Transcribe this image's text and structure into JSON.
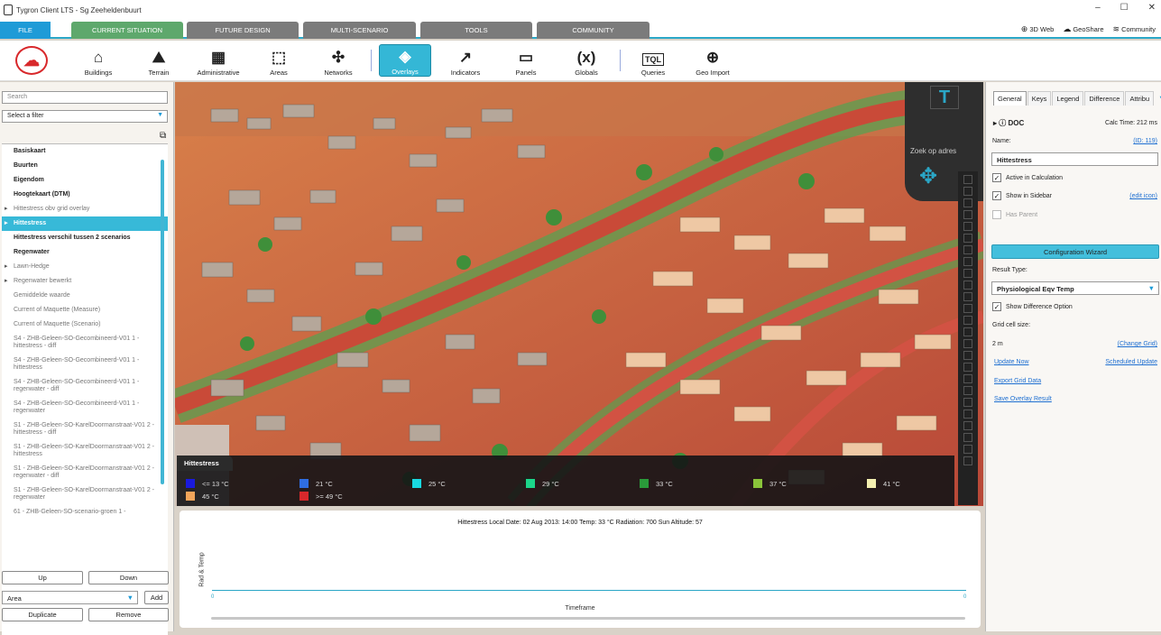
{
  "window": {
    "title": "Tygron Client LTS - Sg Zeeheldenbuurt",
    "minimize": "–",
    "maximize": "☐",
    "close": "✕"
  },
  "tabs": {
    "file": "FILE",
    "current": "CURRENT SITUATION",
    "future": "FUTURE DESIGN",
    "multi": "MULTI-SCENARIO",
    "tools": "TOOLS",
    "community": "COMMUNITY"
  },
  "top_links": {
    "web": "3D Web",
    "geoshare": "GeoShare",
    "community": "Community"
  },
  "ribbon": {
    "buttons": [
      {
        "label": "Buildings",
        "icon": "⌂"
      },
      {
        "label": "Terrain",
        "icon": "⛰"
      },
      {
        "label": "Administrative",
        "icon": "▦"
      },
      {
        "label": "Areas",
        "icon": "⬚"
      },
      {
        "label": "Networks",
        "icon": "✣"
      },
      {
        "label": "Overlays",
        "icon": "◈"
      },
      {
        "label": "Indicators",
        "icon": "↗"
      },
      {
        "label": "Panels",
        "icon": "▭"
      },
      {
        "label": "Globals",
        "icon": "(x)"
      },
      {
        "label": "Queries",
        "icon": "TQL"
      },
      {
        "label": "Geo Import",
        "icon": "⊕"
      }
    ]
  },
  "sidebar": {
    "search_placeholder": "Search",
    "filter": "Select a filter",
    "items": [
      {
        "label": "Basiskaart"
      },
      {
        "label": "Buurten"
      },
      {
        "label": "Eigendom"
      },
      {
        "label": "Hoogtekaart (DTM)"
      },
      {
        "label": "Hittestress obv grid overlay"
      },
      {
        "label": "Hittestress"
      },
      {
        "label": "Hittestress verschil tussen 2 scenarios"
      },
      {
        "label": "Regenwater"
      },
      {
        "label": "Lawn-Hedge"
      },
      {
        "label": "Regenwater bewerkt"
      },
      {
        "label": "Gemiddelde waarde"
      },
      {
        "label": "Current of Maquette (Measure)"
      },
      {
        "label": "Current of Maquette (Scenario)"
      },
      {
        "label": "S4 - ZHB-Geleen-SO-Gecombineerd-V01 1 - hittestress - diff"
      },
      {
        "label": "S4 - ZHB-Geleen-SO-Gecombineerd-V01 1 - hittestress"
      },
      {
        "label": "S4 - ZHB-Geleen-SO-Gecombineerd-V01 1 - regenwater - diff"
      },
      {
        "label": "S4 - ZHB-Geleen-SO-Gecombineerd-V01 1 - regenwater"
      },
      {
        "label": "S1 - ZHB-Geleen-SO-KarelDoormanstraat-V01 2 - hittestress - diff"
      },
      {
        "label": "S1 - ZHB-Geleen-SO-KarelDoormanstraat-V01 2 - hittestress"
      },
      {
        "label": "S1 - ZHB-Geleen-SO-KarelDoormanstraat-V01 2 - regenwater - diff"
      },
      {
        "label": "S1 - ZHB-Geleen-SO-KarelDoormanstraat-V01 2 - regenwater"
      },
      {
        "label": "61 - ZHB-Geleen-SO-scenario-groen 1 -"
      }
    ],
    "up": "Up",
    "down": "Down",
    "area": "Area",
    "add": "Add",
    "duplicate": "Duplicate",
    "remove": "Remove"
  },
  "map": {
    "search_label": "Zoek op adres",
    "logo": "T"
  },
  "legend": {
    "title": "Hittestress",
    "entries": [
      {
        "label": "<= 13 °C",
        "color": "#1a1adc"
      },
      {
        "label": "21 °C",
        "color": "#2f6de0"
      },
      {
        "label": "25 °C",
        "color": "#19d9e0"
      },
      {
        "label": "29 °C",
        "color": "#1bd68a"
      },
      {
        "label": "33 °C",
        "color": "#2a9a3a"
      },
      {
        "label": "37 °C",
        "color": "#8ac43a"
      },
      {
        "label": "41 °C",
        "color": "#f3efb0"
      },
      {
        "label": "45 °C",
        "color": "#f2a55a"
      },
      {
        "label": ">= 49 °C",
        "color": "#d8282b"
      }
    ]
  },
  "graph": {
    "title": "Hittestress Local Date: 02 Aug 2013: 14:00 Temp: 33 °C Radiation: 700 Sun Altitude: 57",
    "ylabel": "Rad & Temp",
    "xlabel": "Timeframe",
    "start": "0",
    "end": "0"
  },
  "rpanel": {
    "tabs": [
      "General",
      "Keys",
      "Legend",
      "Difference",
      "Attribu"
    ],
    "more": "▼",
    "doc": "DOC",
    "calc_time": "Calc Time: 212 ms",
    "name_label": "Name:",
    "id": "(ID: 119)",
    "name": "Hittestress",
    "active": "Active in Calculation",
    "show_sidebar": "Show in Sidebar",
    "edit_icon": "(edit icon)",
    "has_parent": "Has Parent",
    "wizard": "Configuration Wizard",
    "result_type_label": "Result Type:",
    "result_type": "Physiological Eqv Temp",
    "show_diff": "Show Difference Option",
    "grid_label": "Grid cell size:",
    "grid_size": "2 m",
    "change_grid": "(Change Grid)",
    "update_now": "Update Now",
    "scheduled": "Scheduled Update",
    "export": "Export Grid Data",
    "save": "Save Overlay Result"
  }
}
